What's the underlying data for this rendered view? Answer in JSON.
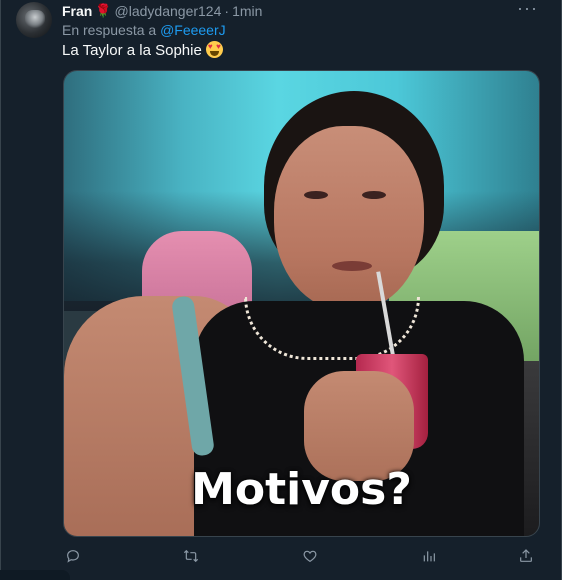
{
  "tweet": {
    "author_name": "Fran",
    "name_emoji": "🌹",
    "handle": "@ladydanger124",
    "separator": "·",
    "time": "1min",
    "more_label": "···",
    "reply_prefix": "En respuesta a",
    "reply_mention": "@FeeeerJ",
    "text": "La Taylor a la Sophie",
    "emoji": "heart-eyes-emoji",
    "media": {
      "caption": "Motivos?"
    }
  },
  "actions": {
    "reply_icon": "reply-icon",
    "retweet_icon": "retweet-icon",
    "like_icon": "like-icon",
    "views_icon": "views-icon",
    "share_icon": "share-icon"
  },
  "colors": {
    "background": "#15202b",
    "link": "#1d9bf0",
    "muted": "#8b98a5",
    "text": "#f7f9f9"
  }
}
